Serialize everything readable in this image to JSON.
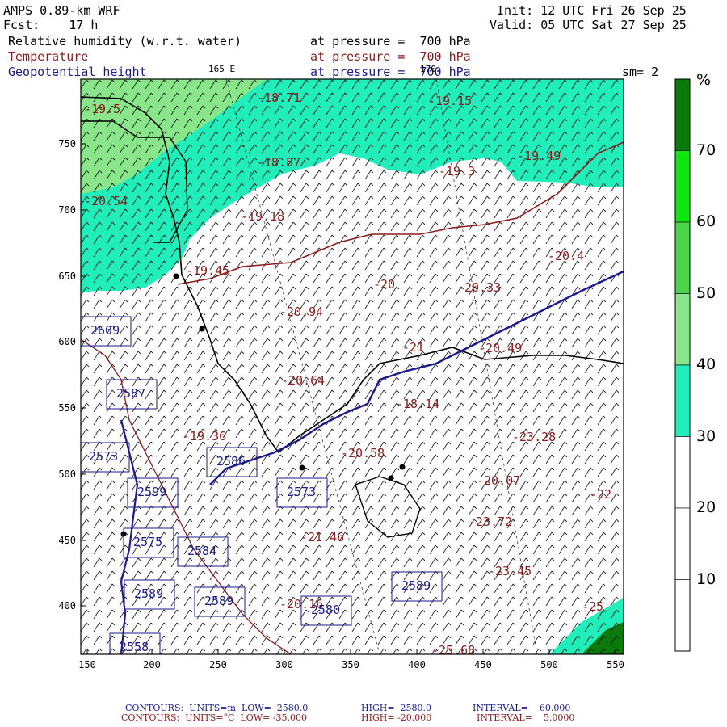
{
  "header": {
    "model": "AMPS 0.89-km WRF",
    "forecast": "Fcst:    17 h",
    "init": "Init: 12 UTC Fri 26 Sep 25",
    "valid": "Valid: 05 UTC Sat 27 Sep 25",
    "field1_name": "Relative humidity (w.r.t. water)",
    "field1_level": "at pressure =  700 hPa",
    "field2_name": "Temperature",
    "field2_level": "at pressure =  700 hPa",
    "field3_name": "Geopotential height",
    "field3_level": "at pressure =  700 hPa",
    "smoothing": "sm= 2",
    "lon_label_1": "165 E",
    "lon_label_2": "170"
  },
  "x_ticks": [
    "150",
    "200",
    "250",
    "300",
    "350",
    "400",
    "450",
    "500",
    "550"
  ],
  "y_ticks": [
    "750",
    "700",
    "650",
    "600",
    "550",
    "500",
    "450",
    "400"
  ],
  "colorbar": {
    "unit": "%",
    "labels": [
      "70",
      "60",
      "50",
      "40",
      "30",
      "20",
      "10"
    ],
    "colors": [
      "#0a7a0a",
      "#11e611",
      "#4dd44d",
      "#8ae68a",
      "#22eebb",
      "#ffffff",
      "#ffffff",
      "#ffffff"
    ]
  },
  "temperature_labels": [
    "-18.71",
    "-19.15",
    "-19.49",
    "-18.87",
    "-19.3",
    "-19.18",
    "-20.54",
    "-20.4",
    "-20",
    "-20.33",
    "-20.94",
    "-21",
    "-20.49",
    "-20.64",
    "-18.14",
    "-20.58",
    "-23.28",
    "-19.36",
    "-23.72",
    "-22",
    "-21.46",
    "-23.45",
    "-25",
    "-20.16",
    "-25.68",
    "-20.07",
    "-19.45",
    "-19.5"
  ],
  "height_labels": [
    "2609",
    "2587",
    "2573",
    "2586",
    "2573",
    "2575",
    "2584",
    "2589",
    "2589",
    "2580",
    "2589",
    "2599",
    "2558"
  ],
  "footer": {
    "line1_label": "CONTOURS:  UNITS=m  LOW=  2580.0",
    "line1_high": "HIGH=  2580.0",
    "line1_interval": "INTERVAL=    60.000",
    "line2_label": "CONTOURS:  UNITS=°C  LOW= -35.000",
    "line2_high": "HIGH= -20.000",
    "line2_interval": "INTERVAL=    5.0000"
  }
}
